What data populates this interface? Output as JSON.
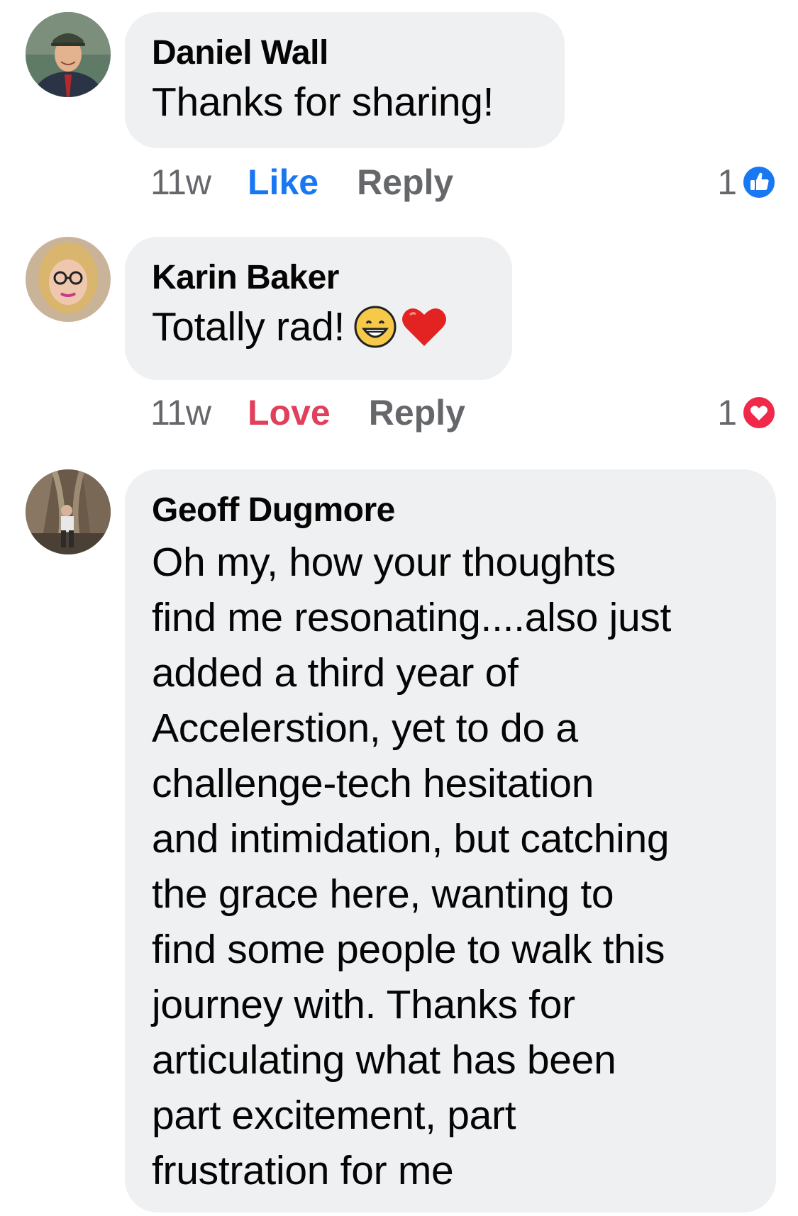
{
  "colors": {
    "like": "#1877f2",
    "love": "#e0405b",
    "secondary_text": "#65676b",
    "bubble_bg": "#eff0f2"
  },
  "comments": [
    {
      "author": "Daniel Wall",
      "lines": [
        "Thanks for sharing!"
      ],
      "time": "11w",
      "reaction_label": "Like",
      "reply_label": "Reply",
      "reaction_count": "1",
      "reaction_icon": "like-icon"
    },
    {
      "author": "Karin Baker",
      "lines": [
        "Totally rad!"
      ],
      "emojis": [
        "grinning-face-icon",
        "red-heart-icon"
      ],
      "time": "11w",
      "reaction_label": "Love",
      "reply_label": "Reply",
      "reaction_count": "1",
      "reaction_icon": "love-icon"
    },
    {
      "author": "Geoff Dugmore",
      "lines": [
        "Oh my, how your thoughts",
        "find me resonating....also just",
        "added a third year of",
        "Accelerstion, yet to do a",
        "challenge-tech hesitation",
        "and intimidation, but catching",
        "the grace here, wanting to",
        "find some people to walk this",
        "journey with. Thanks for",
        "articulating what has been",
        "part excitement, part",
        "frustration for me"
      ]
    }
  ]
}
